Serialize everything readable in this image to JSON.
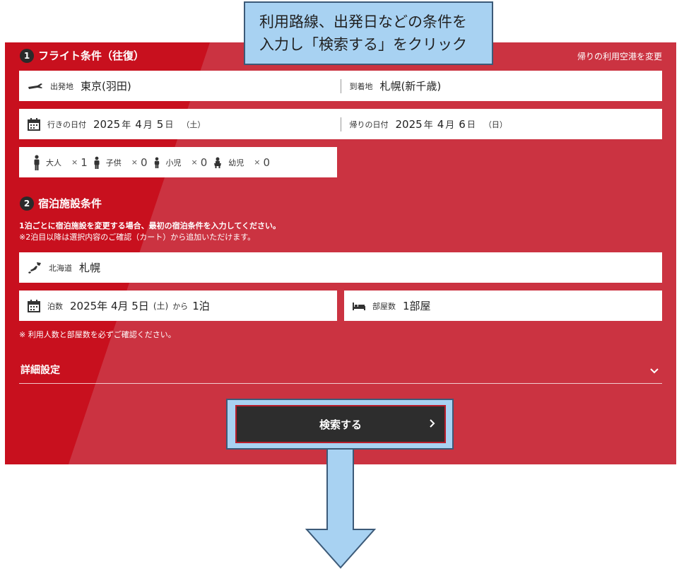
{
  "callout": {
    "line1": "利用路線、出発日などの条件を",
    "line2": "入力し「検索する」をクリック"
  },
  "flight": {
    "number": "1",
    "title": "フライト条件（往復）",
    "change_airport": "帰りの利用空港を変更",
    "departure_label": "出発地",
    "departure_value": "東京(羽田)",
    "arrival_label": "到着地",
    "arrival_value": "札幌(新千歳)",
    "outbound_label": "行きの日付",
    "outbound_year": "2025",
    "outbound_month": "4",
    "outbound_day": "5",
    "outbound_weekday": "（土）",
    "return_label": "帰りの日付",
    "return_year": "2025",
    "return_month": "4",
    "return_day": "6",
    "return_weekday": "（日）",
    "year_unit": "年",
    "month_unit": "月",
    "day_unit": "日",
    "passengers": [
      {
        "label": "大人",
        "times": "×",
        "count": "1"
      },
      {
        "label": "子供",
        "times": "×",
        "count": "0"
      },
      {
        "label": "小児",
        "times": "×",
        "count": "0"
      },
      {
        "label": "幼児",
        "times": "×",
        "count": "0"
      }
    ]
  },
  "hotel": {
    "number": "2",
    "title": "宿泊施設条件",
    "notice1": "1泊ごとに宿泊施設を変更する場合、最初の宿泊条件を入力してください。",
    "notice2": "※2泊目以降は選択内容のご確認（カート）から追加いただけます。",
    "area_label": "北海道",
    "area_value": "札幌",
    "nights_label": "泊数",
    "nights_date": "2025年 4月 5日",
    "nights_weekday": "(土)",
    "nights_from": "から",
    "nights_value": "1泊",
    "rooms_label": "部屋数",
    "rooms_value": "1部屋",
    "confirm_notice": "※ 利用人数と部屋数を必ずご確認ください。"
  },
  "details": {
    "label": "詳細設定"
  },
  "search": {
    "label": "検索する"
  },
  "colors": {
    "panel": "#cb3341",
    "panel_dark": "#c8101e",
    "callout": "#a8d2f2",
    "button": "#2d2d2d"
  }
}
